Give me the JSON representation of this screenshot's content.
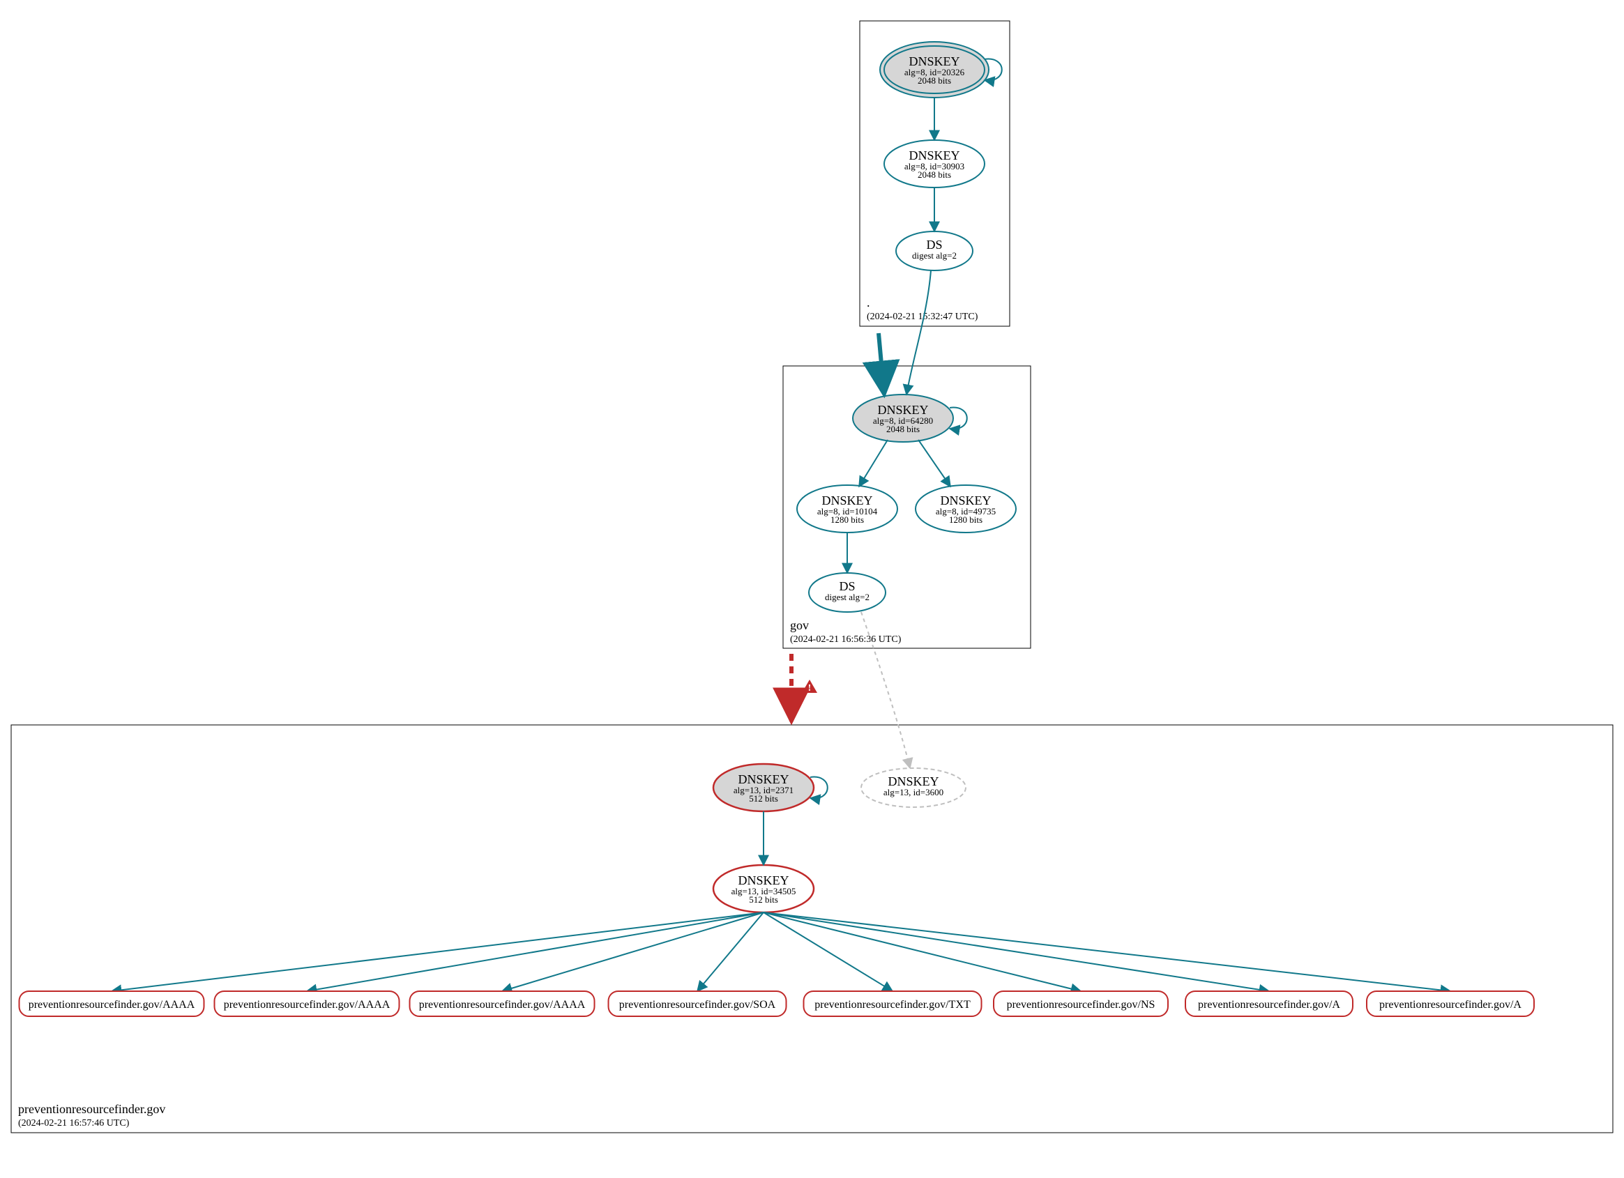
{
  "zones": {
    "root": {
      "label": ".",
      "timestamp": "(2024-02-21 15:32:47 UTC)"
    },
    "gov": {
      "label": "gov",
      "timestamp": "(2024-02-21 16:56:36 UTC)"
    },
    "domain": {
      "label": "preventionresourcefinder.gov",
      "timestamp": "(2024-02-21 16:57:46 UTC)"
    }
  },
  "nodes": {
    "root_ksk": {
      "title": "DNSKEY",
      "line2": "alg=8, id=20326",
      "line3": "2048 bits"
    },
    "root_zsk": {
      "title": "DNSKEY",
      "line2": "alg=8, id=30903",
      "line3": "2048 bits"
    },
    "root_ds": {
      "title": "DS",
      "line2": "digest alg=2"
    },
    "gov_ksk": {
      "title": "DNSKEY",
      "line2": "alg=8, id=64280",
      "line3": "2048 bits"
    },
    "gov_zsk1": {
      "title": "DNSKEY",
      "line2": "alg=8, id=10104",
      "line3": "1280 bits"
    },
    "gov_zsk2": {
      "title": "DNSKEY",
      "line2": "alg=8, id=49735",
      "line3": "1280 bits"
    },
    "gov_ds": {
      "title": "DS",
      "line2": "digest alg=2"
    },
    "prf_ksk": {
      "title": "DNSKEY",
      "line2": "alg=13, id=2371",
      "line3": "512 bits"
    },
    "prf_zsk": {
      "title": "DNSKEY",
      "line2": "alg=13, id=34505",
      "line3": "512 bits"
    },
    "prf_nods": {
      "title": "DNSKEY",
      "line2": "alg=13, id=3600"
    }
  },
  "rrsets": [
    "preventionresourcefinder.gov/AAAA",
    "preventionresourcefinder.gov/AAAA",
    "preventionresourcefinder.gov/AAAA",
    "preventionresourcefinder.gov/SOA",
    "preventionresourcefinder.gov/TXT",
    "preventionresourcefinder.gov/NS",
    "preventionresourcefinder.gov/A",
    "preventionresourcefinder.gov/A"
  ],
  "colors": {
    "secure": "#11788a",
    "insecure": "#c02a2a",
    "gray": "#bfbfbf",
    "fillGray": "#d6d6d6"
  }
}
